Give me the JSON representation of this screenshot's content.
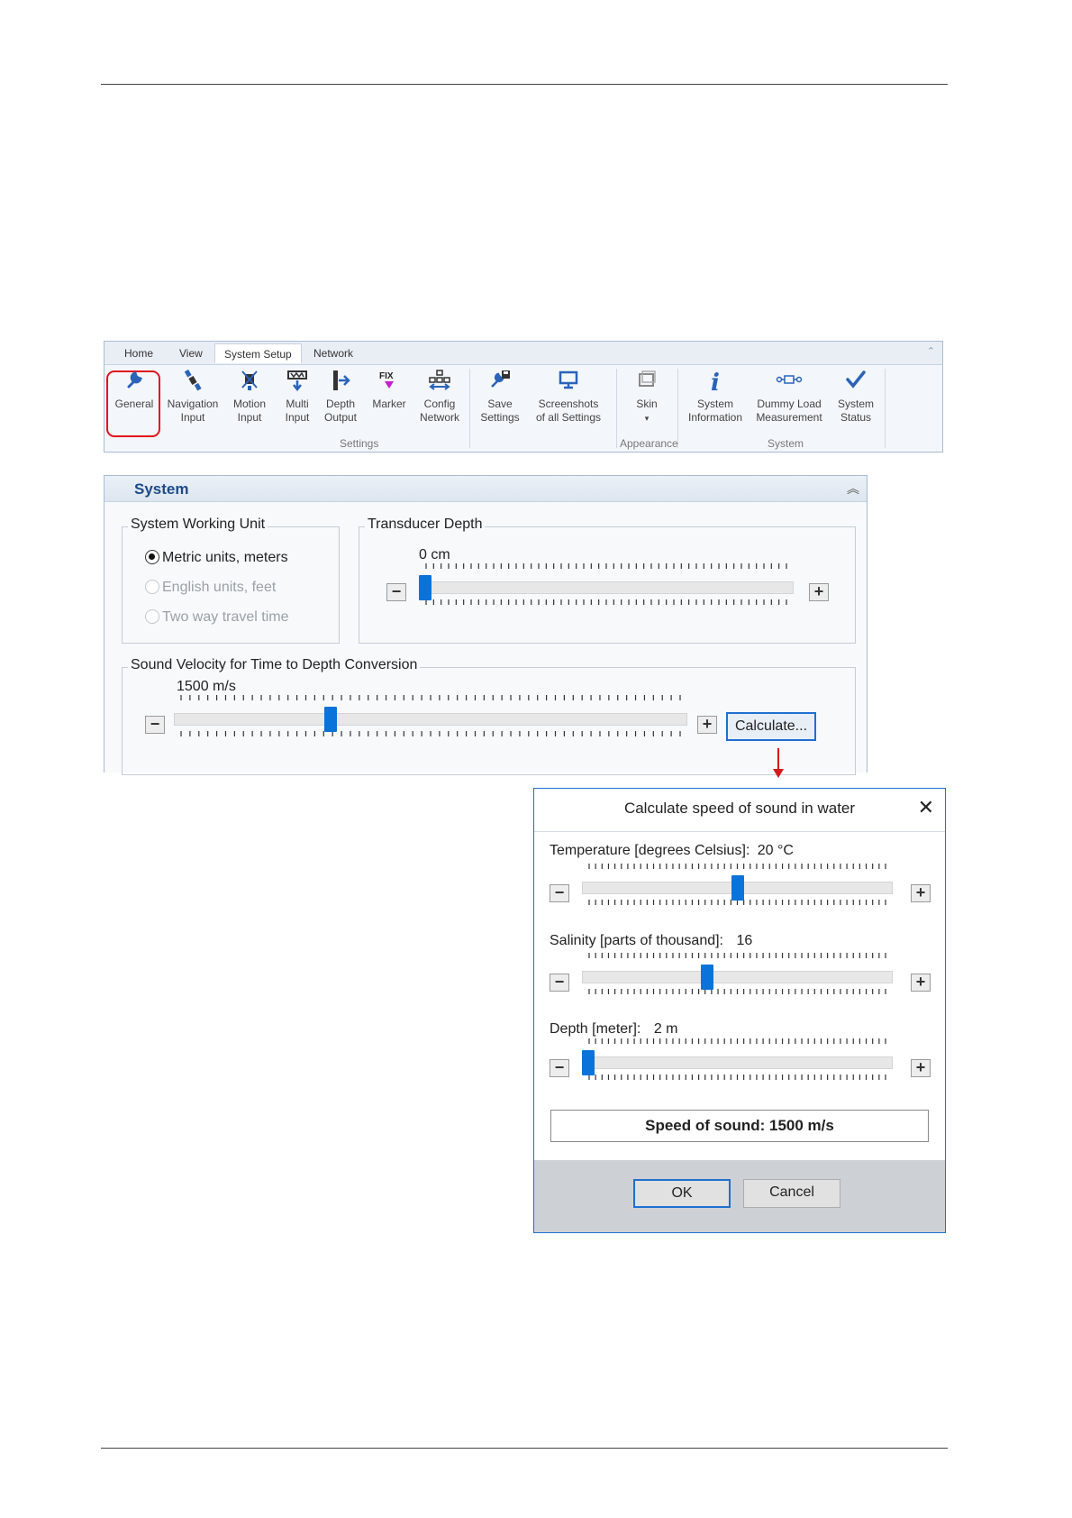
{
  "ribbon": {
    "tabs": [
      {
        "label": "Home"
      },
      {
        "label": "View"
      },
      {
        "label": "System Setup"
      },
      {
        "label": "Network"
      }
    ],
    "buttons": [
      {
        "line1": "General",
        "line2": "",
        "icon": "wrench-icon"
      },
      {
        "line1": "Navigation",
        "line2": "Input",
        "icon": "satellite-icon"
      },
      {
        "line1": "Motion",
        "line2": "Input",
        "icon": "motion-sensor-icon"
      },
      {
        "line1": "Multi",
        "line2": "Input",
        "icon": "multi-input-icon"
      },
      {
        "line1": "Depth",
        "line2": "Output",
        "icon": "depth-output-icon"
      },
      {
        "line1": "Marker",
        "line2": "",
        "icon": "fix-marker-icon"
      },
      {
        "line1": "Config",
        "line2": "Network",
        "icon": "network-config-icon"
      },
      {
        "line1": "Save",
        "line2": "Settings",
        "icon": "save-settings-icon"
      },
      {
        "line1": "Screenshots",
        "line2": "of all Settings",
        "icon": "monitor-icon"
      },
      {
        "line1": "Skin",
        "line2": "▾",
        "icon": "window-skin-icon"
      },
      {
        "line1": "System",
        "line2": "Information",
        "icon": "info-icon"
      },
      {
        "line1": "Dummy Load",
        "line2": "Measurement",
        "icon": "dummy-load-icon"
      },
      {
        "line1": "System",
        "line2": "Status",
        "icon": "checkmark-icon"
      }
    ],
    "groups": {
      "settings": "Settings",
      "appearance": "Appearance",
      "system": "System"
    }
  },
  "system_panel": {
    "title": "System",
    "working_unit": {
      "legend": "System Working Unit",
      "options": [
        {
          "label": "Metric units, meters",
          "selected": true,
          "enabled": true
        },
        {
          "label": "English units, feet",
          "selected": false,
          "enabled": false
        },
        {
          "label": "Two way travel time",
          "selected": false,
          "enabled": false
        }
      ]
    },
    "transducer_depth": {
      "legend": "Transducer Depth",
      "value_text": "0 cm",
      "level": 0.0
    },
    "sound_velocity": {
      "legend": "Sound Velocity for Time to Depth Conversion",
      "value_text": "1500 m/s",
      "level": 0.3,
      "calculate_label": "Calculate..."
    }
  },
  "dialog": {
    "title": "Calculate speed of sound in water",
    "temperature": {
      "label": "Temperature [degrees Celsius]:",
      "value": "20 °C",
      "level": 0.5
    },
    "salinity": {
      "label": "Salinity [parts of thousand]:",
      "value": "16",
      "level": 0.4
    },
    "depth": {
      "label": "Depth [meter]:",
      "value": "2 m",
      "level": 0.0
    },
    "result": "Speed of sound: 1500 m/s",
    "ok_label": "OK",
    "cancel_label": "Cancel"
  },
  "colors": {
    "accent": "#0a73d9",
    "highlight": "#e1141e",
    "panel_title": "#1d4a86"
  }
}
